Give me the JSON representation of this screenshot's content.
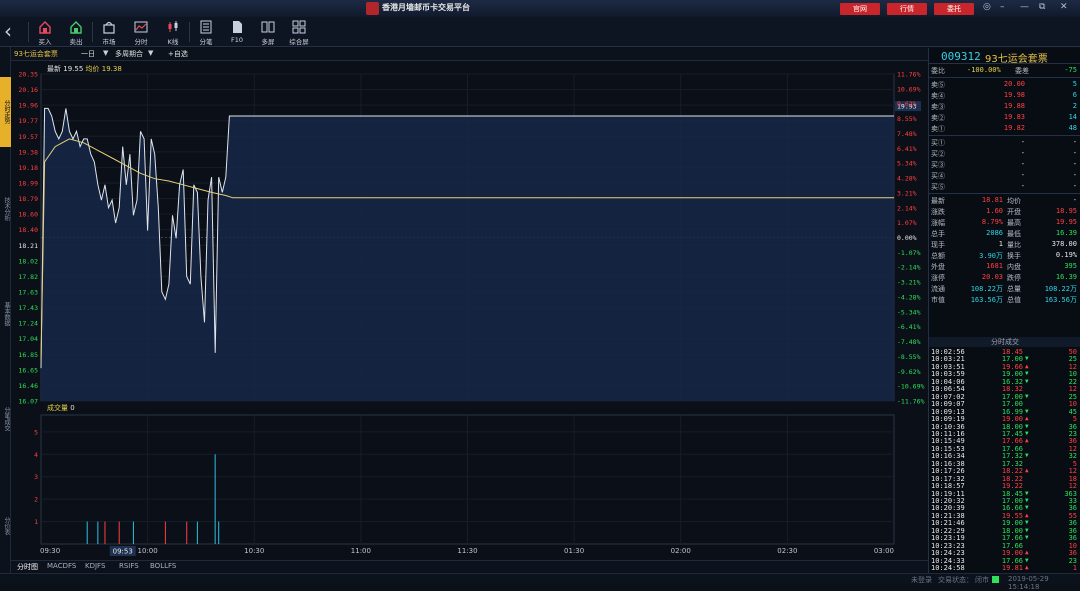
{
  "app": {
    "title": "香港月墙邮币卡交易平台",
    "top_buttons": [
      "官网",
      "行情",
      "委托"
    ],
    "window_controls": [
      "◎",
      "–",
      "—",
      "⧉",
      "✕"
    ]
  },
  "toolbar": [
    {
      "label": "买入",
      "icon": "buy-icon"
    },
    {
      "label": "卖出",
      "icon": "sell-icon"
    },
    {
      "label": "市场",
      "icon": "market-icon"
    },
    {
      "label": "分时",
      "icon": "timeshare-icon"
    },
    {
      "label": "K线",
      "icon": "kline-icon"
    },
    {
      "label": "分笔",
      "icon": "ticks-icon"
    },
    {
      "label": "F10",
      "icon": "f10-icon"
    },
    {
      "label": "多屏",
      "icon": "multiscreen-icon"
    },
    {
      "label": "综合屏",
      "icon": "composite-icon"
    }
  ],
  "left_tabs": [
    "分时走势",
    "技术分析",
    "基本数据",
    "分笔成交",
    "分价表"
  ],
  "chart_bar": {
    "name": "93七运会套票",
    "period": "一日",
    "combo": "多周期合",
    "add": "+自选"
  },
  "chart_data": {
    "type": "line",
    "legend": {
      "latest_label": "最新",
      "latest": "19.55",
      "avg_label": "均价",
      "avg": "19.38"
    },
    "prev_close": 18.21,
    "price_ticks": [
      "20.35",
      "20.16",
      "19.96",
      "19.77",
      "19.57",
      "19.38",
      "19.18",
      "18.99",
      "18.79",
      "18.60",
      "18.40",
      "18.21",
      "18.02",
      "17.82",
      "17.63",
      "17.43",
      "17.24",
      "17.04",
      "16.85",
      "16.65",
      "16.46",
      "16.07"
    ],
    "pct_ticks": [
      "11.76%",
      "10.69%",
      "9.62%",
      "8.55%",
      "7.48%",
      "6.41%",
      "5.34%",
      "4.28%",
      "3.21%",
      "2.14%",
      "1.07%",
      "0.00%",
      "-1.07%",
      "-2.14%",
      "-3.21%",
      "-4.28%",
      "-5.34%",
      "-6.41%",
      "-7.48%",
      "-8.55%",
      "-9.62%",
      "-10.69%",
      "-11.76%"
    ],
    "last_price_tag": "19.93",
    "time_labels": [
      "09:30",
      "10:00",
      "10:30",
      "11:00",
      "11:30",
      "01:30",
      "02:00",
      "02:30",
      "03:00"
    ],
    "cursor_time": "09:53",
    "price_series": [
      [
        0,
        16.5
      ],
      [
        1,
        19.9
      ],
      [
        2,
        19.9
      ],
      [
        3,
        19.8
      ],
      [
        4,
        19.6
      ],
      [
        5,
        19.5
      ],
      [
        6,
        19.6
      ],
      [
        7,
        19.9
      ],
      [
        8,
        19.6
      ],
      [
        9,
        19.5
      ],
      [
        10,
        19.6
      ],
      [
        11,
        19.4
      ],
      [
        12,
        19.5
      ],
      [
        13,
        19.5
      ],
      [
        14,
        19.3
      ],
      [
        15,
        19.2
      ],
      [
        16,
        18.9
      ],
      [
        17,
        18.7
      ],
      [
        18,
        18.9
      ],
      [
        19,
        18.6
      ],
      [
        20,
        18.7
      ],
      [
        21,
        18.4
      ],
      [
        22,
        18.6
      ],
      [
        23,
        19.4
      ],
      [
        24,
        18.9
      ],
      [
        25,
        19.3
      ],
      [
        26,
        18.5
      ],
      [
        27,
        18.7
      ],
      [
        28,
        19.6
      ],
      [
        29,
        19.5
      ],
      [
        30,
        18.3
      ],
      [
        31,
        19.5
      ],
      [
        32,
        19.3
      ],
      [
        33,
        18.6
      ],
      [
        34,
        17.5
      ],
      [
        35,
        17.4
      ],
      [
        36,
        17.6
      ],
      [
        37,
        18.5
      ],
      [
        38,
        18.2
      ],
      [
        39,
        18.9
      ],
      [
        40,
        19.1
      ],
      [
        41,
        17.7
      ],
      [
        42,
        17.6
      ],
      [
        43,
        18.9
      ],
      [
        44,
        18.8
      ],
      [
        45,
        17.7
      ],
      [
        46,
        17.1
      ],
      [
        47,
        18.7
      ],
      [
        48,
        19.0
      ],
      [
        49,
        16.7
      ],
      [
        50,
        19.0
      ],
      [
        51,
        18.8
      ],
      [
        52,
        19.0
      ],
      [
        53,
        19.8
      ],
      [
        54,
        19.8
      ],
      [
        240,
        19.8
      ]
    ],
    "avg_series": [
      [
        0,
        16.6
      ],
      [
        1,
        19.2
      ],
      [
        4,
        19.4
      ],
      [
        8,
        19.5
      ],
      [
        12,
        19.45
      ],
      [
        16,
        19.35
      ],
      [
        20,
        19.25
      ],
      [
        24,
        19.15
      ],
      [
        28,
        19.05
      ],
      [
        32,
        18.98
      ],
      [
        36,
        18.95
      ],
      [
        40,
        18.9
      ],
      [
        44,
        18.85
      ],
      [
        48,
        18.8
      ],
      [
        52,
        18.76
      ],
      [
        54,
        18.73
      ],
      [
        240,
        18.73
      ]
    ],
    "volume_label": "成交量",
    "volume_value": "0",
    "volume_ticks": [
      "5",
      "4",
      "3",
      "2",
      "1"
    ],
    "volume_bars": [
      [
        13,
        1,
        "#30c0e0"
      ],
      [
        16,
        1,
        "#30c0e0"
      ],
      [
        18,
        1,
        "#ff4040"
      ],
      [
        22,
        1,
        "#ff4040"
      ],
      [
        26,
        1,
        "#30c0e0"
      ],
      [
        35,
        1,
        "#ff4040"
      ],
      [
        41,
        1,
        "#ff4040"
      ],
      [
        44,
        1,
        "#30c0e0"
      ],
      [
        49,
        4,
        "#30c0e0"
      ],
      [
        50,
        1,
        "#30c0e0"
      ]
    ]
  },
  "bottom_tabs": [
    "分时图",
    "MACDFS",
    "KDJFS",
    "RSIFS",
    "BOLLFS"
  ],
  "status": {
    "left": "未登录",
    "state_label": "交易状态：",
    "state": "闭市",
    "datetime": "2019-05-29 15:14:18"
  },
  "quote": {
    "code": "009312",
    "name": "93七运会套票",
    "ratio": {
      "label": "委比",
      "value": "-100.00%",
      "diff_label": "委差",
      "diff": "-75"
    },
    "asks": [
      {
        "label": "卖⑤",
        "price": "20.00",
        "vol": "5"
      },
      {
        "label": "卖④",
        "price": "19.98",
        "vol": "6"
      },
      {
        "label": "卖③",
        "price": "19.88",
        "vol": "2"
      },
      {
        "label": "卖②",
        "price": "19.83",
        "vol": "14"
      },
      {
        "label": "卖①",
        "price": "19.82",
        "vol": "48"
      }
    ],
    "bids": [
      {
        "label": "买①",
        "price": "-",
        "vol": "-"
      },
      {
        "label": "买②",
        "price": "-",
        "vol": "-"
      },
      {
        "label": "买③",
        "price": "-",
        "vol": "-"
      },
      {
        "label": "买④",
        "price": "-",
        "vol": "-"
      },
      {
        "label": "买⑤",
        "price": "-",
        "vol": "-"
      }
    ],
    "stats": [
      [
        {
          "label": "最新",
          "value": "18.81",
          "c": "red"
        },
        {
          "label": "均价",
          "value": "-",
          "c": "wht"
        }
      ],
      [
        {
          "label": "涨跌",
          "value": "1.60",
          "c": "red"
        },
        {
          "label": "开盘",
          "value": "18.95",
          "c": "red"
        }
      ],
      [
        {
          "label": "涨幅",
          "value": "8.79%",
          "c": "red"
        },
        {
          "label": "最高",
          "value": "19.95",
          "c": "red"
        }
      ],
      [
        {
          "label": "总手",
          "value": "2086",
          "c": "cyn"
        },
        {
          "label": "最低",
          "value": "16.39",
          "c": "grn"
        }
      ],
      [
        {
          "label": "现手",
          "value": "1",
          "c": "wht"
        },
        {
          "label": "量比",
          "value": "378.00",
          "c": "wht"
        }
      ],
      [
        {
          "label": "总额",
          "value": "3.90万",
          "c": "cyn"
        },
        {
          "label": "换手",
          "value": "0.19%",
          "c": "wht"
        }
      ],
      [
        {
          "label": "外盘",
          "value": "1681",
          "c": "red"
        },
        {
          "label": "内盘",
          "value": "395",
          "c": "grn"
        }
      ],
      [
        {
          "label": "涨停",
          "value": "20.03",
          "c": "red"
        },
        {
          "label": "跌停",
          "value": "16.39",
          "c": "grn"
        }
      ],
      [
        {
          "label": "流通",
          "value": "108.22万",
          "c": "cyn"
        },
        {
          "label": "总量",
          "value": "108.22万",
          "c": "cyn"
        }
      ],
      [
        {
          "label": "市值",
          "value": "163.56万",
          "c": "cyn"
        },
        {
          "label": "总值",
          "value": "163.56万",
          "c": "cyn"
        }
      ]
    ]
  },
  "trades_title": "分时成交",
  "trades": [
    [
      "10:02:56",
      "18.45",
      "",
      "50"
    ],
    [
      "10:03:21",
      "17.00",
      "down",
      "25"
    ],
    [
      "10:03:51",
      "19.66",
      "up",
      "12"
    ],
    [
      "10:03:59",
      "19.00",
      "down",
      "10"
    ],
    [
      "10:04:06",
      "16.32",
      "down",
      "22"
    ],
    [
      "10:06:54",
      "18.32",
      "",
      "12"
    ],
    [
      "10:07:02",
      "17.00",
      "down",
      "25"
    ],
    [
      "10:09:07",
      "17.00",
      "",
      "10"
    ],
    [
      "10:09:13",
      "16.99",
      "down",
      "45"
    ],
    [
      "10:09:19",
      "19.00",
      "up",
      "5"
    ],
    [
      "10:10:36",
      "18.00",
      "down",
      "36"
    ],
    [
      "10:11:16",
      "17.45",
      "down",
      "23"
    ],
    [
      "10:15:49",
      "17.66",
      "up",
      "36"
    ],
    [
      "10:15:53",
      "17.66",
      "",
      "12"
    ],
    [
      "10:16:34",
      "17.32",
      "down",
      "32"
    ],
    [
      "10:16:38",
      "17.32",
      "",
      "5"
    ],
    [
      "10:17:26",
      "18.22",
      "up",
      "12"
    ],
    [
      "10:17:32",
      "18.22",
      "",
      "18"
    ],
    [
      "10:18:57",
      "19.22",
      "",
      "12"
    ],
    [
      "10:19:11",
      "18.45",
      "down",
      "363"
    ],
    [
      "10:20:32",
      "17.00",
      "down",
      "33"
    ],
    [
      "10:20:39",
      "16.66",
      "down",
      "36"
    ],
    [
      "10:21:38",
      "19.55",
      "up",
      "55"
    ],
    [
      "10:21:46",
      "19.00",
      "down",
      "36"
    ],
    [
      "10:22:29",
      "18.00",
      "down",
      "36"
    ],
    [
      "10:23:19",
      "17.66",
      "down",
      "36"
    ],
    [
      "10:23:23",
      "17.66",
      "",
      "10"
    ],
    [
      "10:24:23",
      "19.00",
      "up",
      "36"
    ],
    [
      "10:24:33",
      "17.66",
      "down",
      "23"
    ],
    [
      "10:24:58",
      "19.81",
      "up",
      "1"
    ]
  ]
}
